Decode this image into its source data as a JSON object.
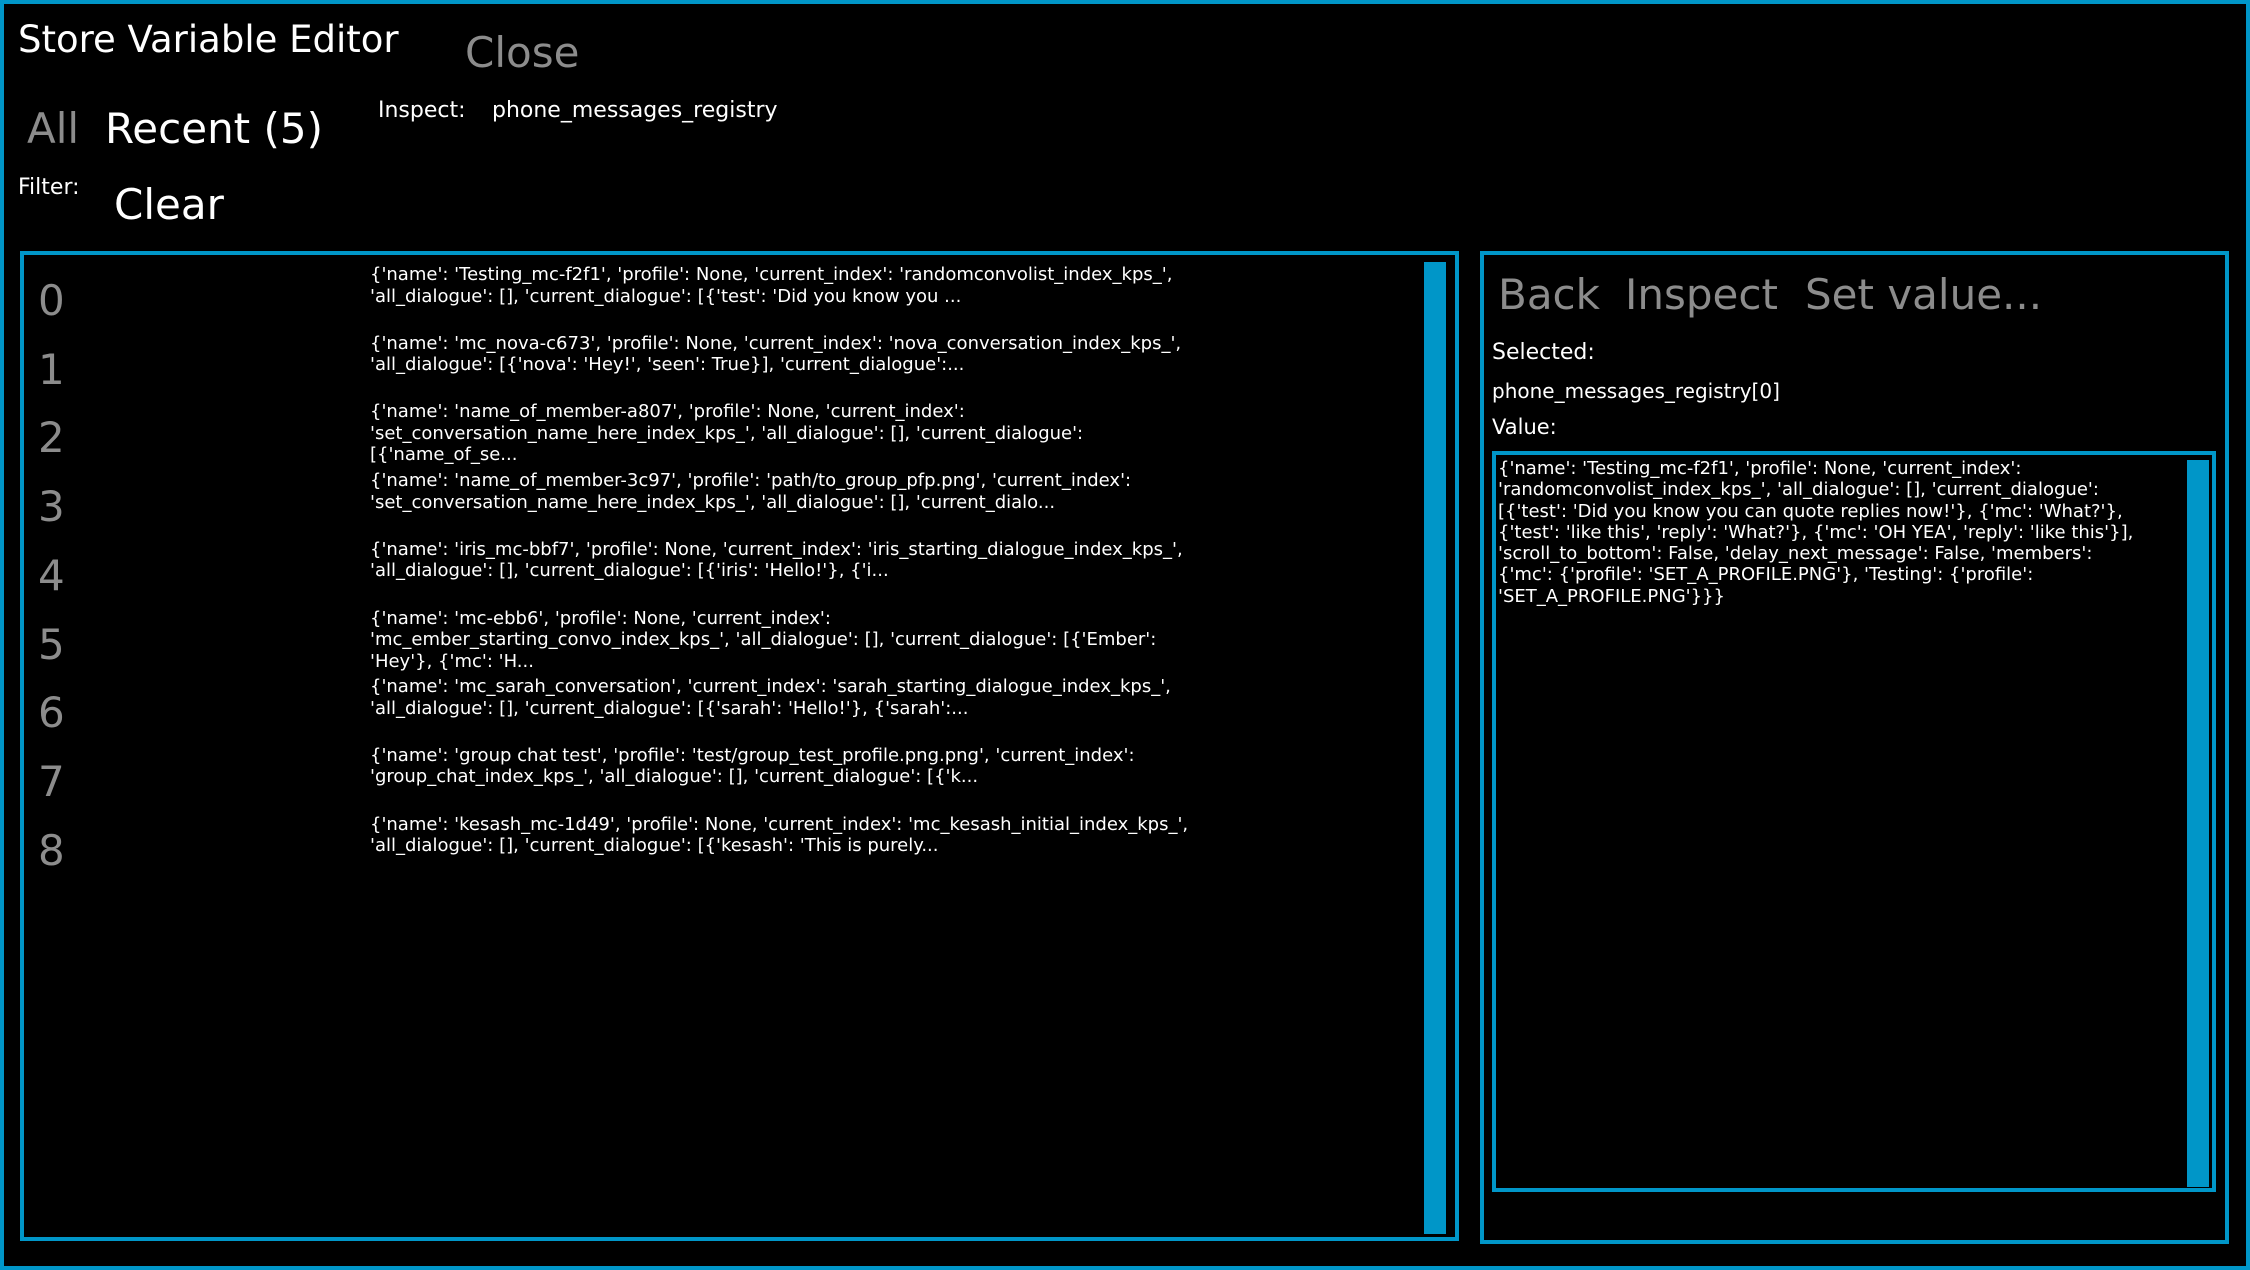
{
  "window": {
    "title": "Store Variable Editor",
    "close_label": "Close"
  },
  "tabs": {
    "all_label": "All",
    "recent_label": "Recent (5)"
  },
  "inspect": {
    "label": "Inspect:",
    "value": "phone_messages_registry"
  },
  "filter": {
    "label": "Filter:",
    "clear_label": "Clear"
  },
  "list": {
    "rows": [
      {
        "index": "0",
        "value": "{'name': 'Testing_mc-f2f1', 'profile': None, 'current_index': 'randomconvolist_index_kps_',\n'all_dialogue': [], 'current_dialogue': [{'test': 'Did you know you ..."
      },
      {
        "index": "1",
        "value": "{'name': 'mc_nova-c673', 'profile': None, 'current_index': 'nova_conversation_index_kps_',\n'all_dialogue': [{'nova': 'Hey!', 'seen': True}], 'current_dialogue':..."
      },
      {
        "index": "2",
        "value": "{'name': 'name_of_member-a807', 'profile': None, 'current_index':\n'set_conversation_name_here_index_kps_', 'all_dialogue': [], 'current_dialogue':\n[{'name_of_se..."
      },
      {
        "index": "3",
        "value": "{'name': 'name_of_member-3c97', 'profile': 'path/to_group_pfp.png', 'current_index':\n'set_conversation_name_here_index_kps_', 'all_dialogue': [], 'current_dialo..."
      },
      {
        "index": "4",
        "value": "{'name': 'iris_mc-bbf7', 'profile': None, 'current_index': 'iris_starting_dialogue_index_kps_',\n'all_dialogue': [], 'current_dialogue': [{'iris': 'Hello!'}, {'i..."
      },
      {
        "index": "5",
        "value": "{'name': 'mc-ebb6', 'profile': None, 'current_index':\n'mc_ember_starting_convo_index_kps_', 'all_dialogue': [], 'current_dialogue': [{'Ember':\n'Hey'}, {'mc': 'H..."
      },
      {
        "index": "6",
        "value": "{'name': 'mc_sarah_conversation', 'current_index': 'sarah_starting_dialogue_index_kps_',\n'all_dialogue': [], 'current_dialogue': [{'sarah': 'Hello!'}, {'sarah':..."
      },
      {
        "index": "7",
        "value": "{'name': 'group chat test', 'profile': 'test/group_test_profile.png.png', 'current_index':\n'group_chat_index_kps_', 'all_dialogue': [], 'current_dialogue': [{'k..."
      },
      {
        "index": "8",
        "value": "{'name': 'kesash_mc-1d49', 'profile': None, 'current_index': 'mc_kesash_initial_index_kps_',\n'all_dialogue': [], 'current_dialogue': [{'kesash': 'This is purely..."
      }
    ]
  },
  "detail": {
    "back_label": "Back",
    "inspect_label": "Inspect",
    "set_value_label": "Set value...",
    "selected_label": "Selected:",
    "selected_path": "phone_messages_registry[0]",
    "value_label": "Value:",
    "value_text": "{'name': 'Testing_mc-f2f1', 'profile': None, 'current_index':\n'randomconvolist_index_kps_', 'all_dialogue': [], 'current_dialogue':\n[{'test': 'Did you know you can quote replies now!'}, {'mc': 'What?'},\n{'test': 'like this', 'reply': 'What?'}, {'mc': 'OH YEA', 'reply': 'like this'}],\n'scroll_to_bottom': False, 'delay_next_message': False, 'members':\n{'mc': {'profile': 'SET_A_PROFILE.PNG'}, 'Testing': {'profile':\n'SET_A_PROFILE.PNG'}}}"
  },
  "colors": {
    "accent": "#0096c8",
    "background": "#000000",
    "text": "#ffffff",
    "muted": "#8c8c8c"
  }
}
